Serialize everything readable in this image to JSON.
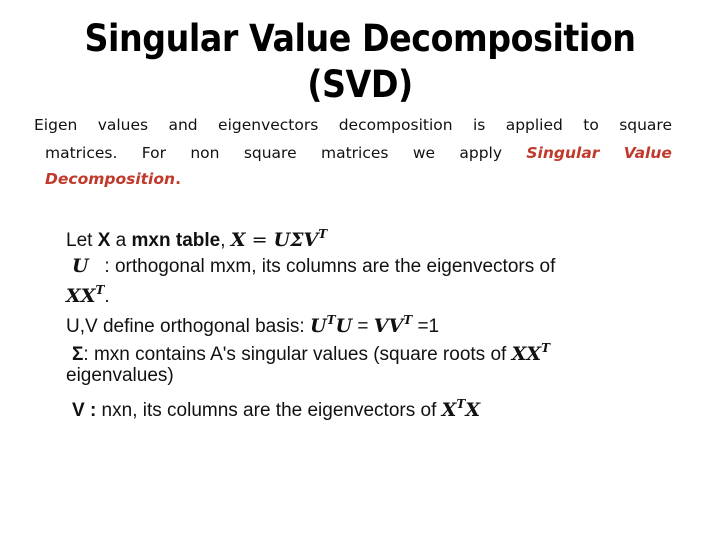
{
  "slide": {
    "title_line1": "Singular Value Decomposition",
    "title_line2": "(SVD)",
    "accent_color": "#c0392b",
    "intro": {
      "line1_words": [
        "Eigen",
        "values",
        "and",
        "eigenvectors",
        "decomposition",
        "is",
        "applied",
        "to",
        "square"
      ],
      "line2_words": [
        "matrices.",
        "For",
        "non",
        "square",
        "matrices",
        "we",
        "apply"
      ],
      "highlight_part1": "Singular",
      "highlight_part2": "Value",
      "highlight_part3": "Decomposition",
      "end_period": "."
    },
    "body": {
      "r1": {
        "pre": "Let ",
        "bold1": "X",
        "mid": " a ",
        "bold2": "mxn table",
        "comma": ", ",
        "eq_lhs": "X",
        "eq_sign": " = ",
        "eq_rhs": "UΣV",
        "sup": "T"
      },
      "r2": {
        "sym": "U",
        "text": "   : orthogonal mxm, its columns are the eigenvectors of"
      },
      "r3": {
        "sym": "XX",
        "sup": "T",
        "text": "."
      },
      "r4": {
        "pre": "U,V define orthogonal basis: ",
        "a": "U",
        "a_sup": "T",
        "b": "U",
        "eq": " = ",
        "c": "VV",
        "c_sup": "T",
        "post": " =1"
      },
      "r5": {
        "sym": "Σ",
        "text": ": mxn contains A's singular values (square roots of ",
        "m": "XX",
        "m_sup": "T"
      },
      "r6": {
        "text": "eigenvalues)"
      },
      "r7": {
        "sym": "V :",
        "text": " nxn, its columns are the eigenvectors of ",
        "m1": "X",
        "m_sup": "T",
        "m2": "X"
      }
    }
  }
}
